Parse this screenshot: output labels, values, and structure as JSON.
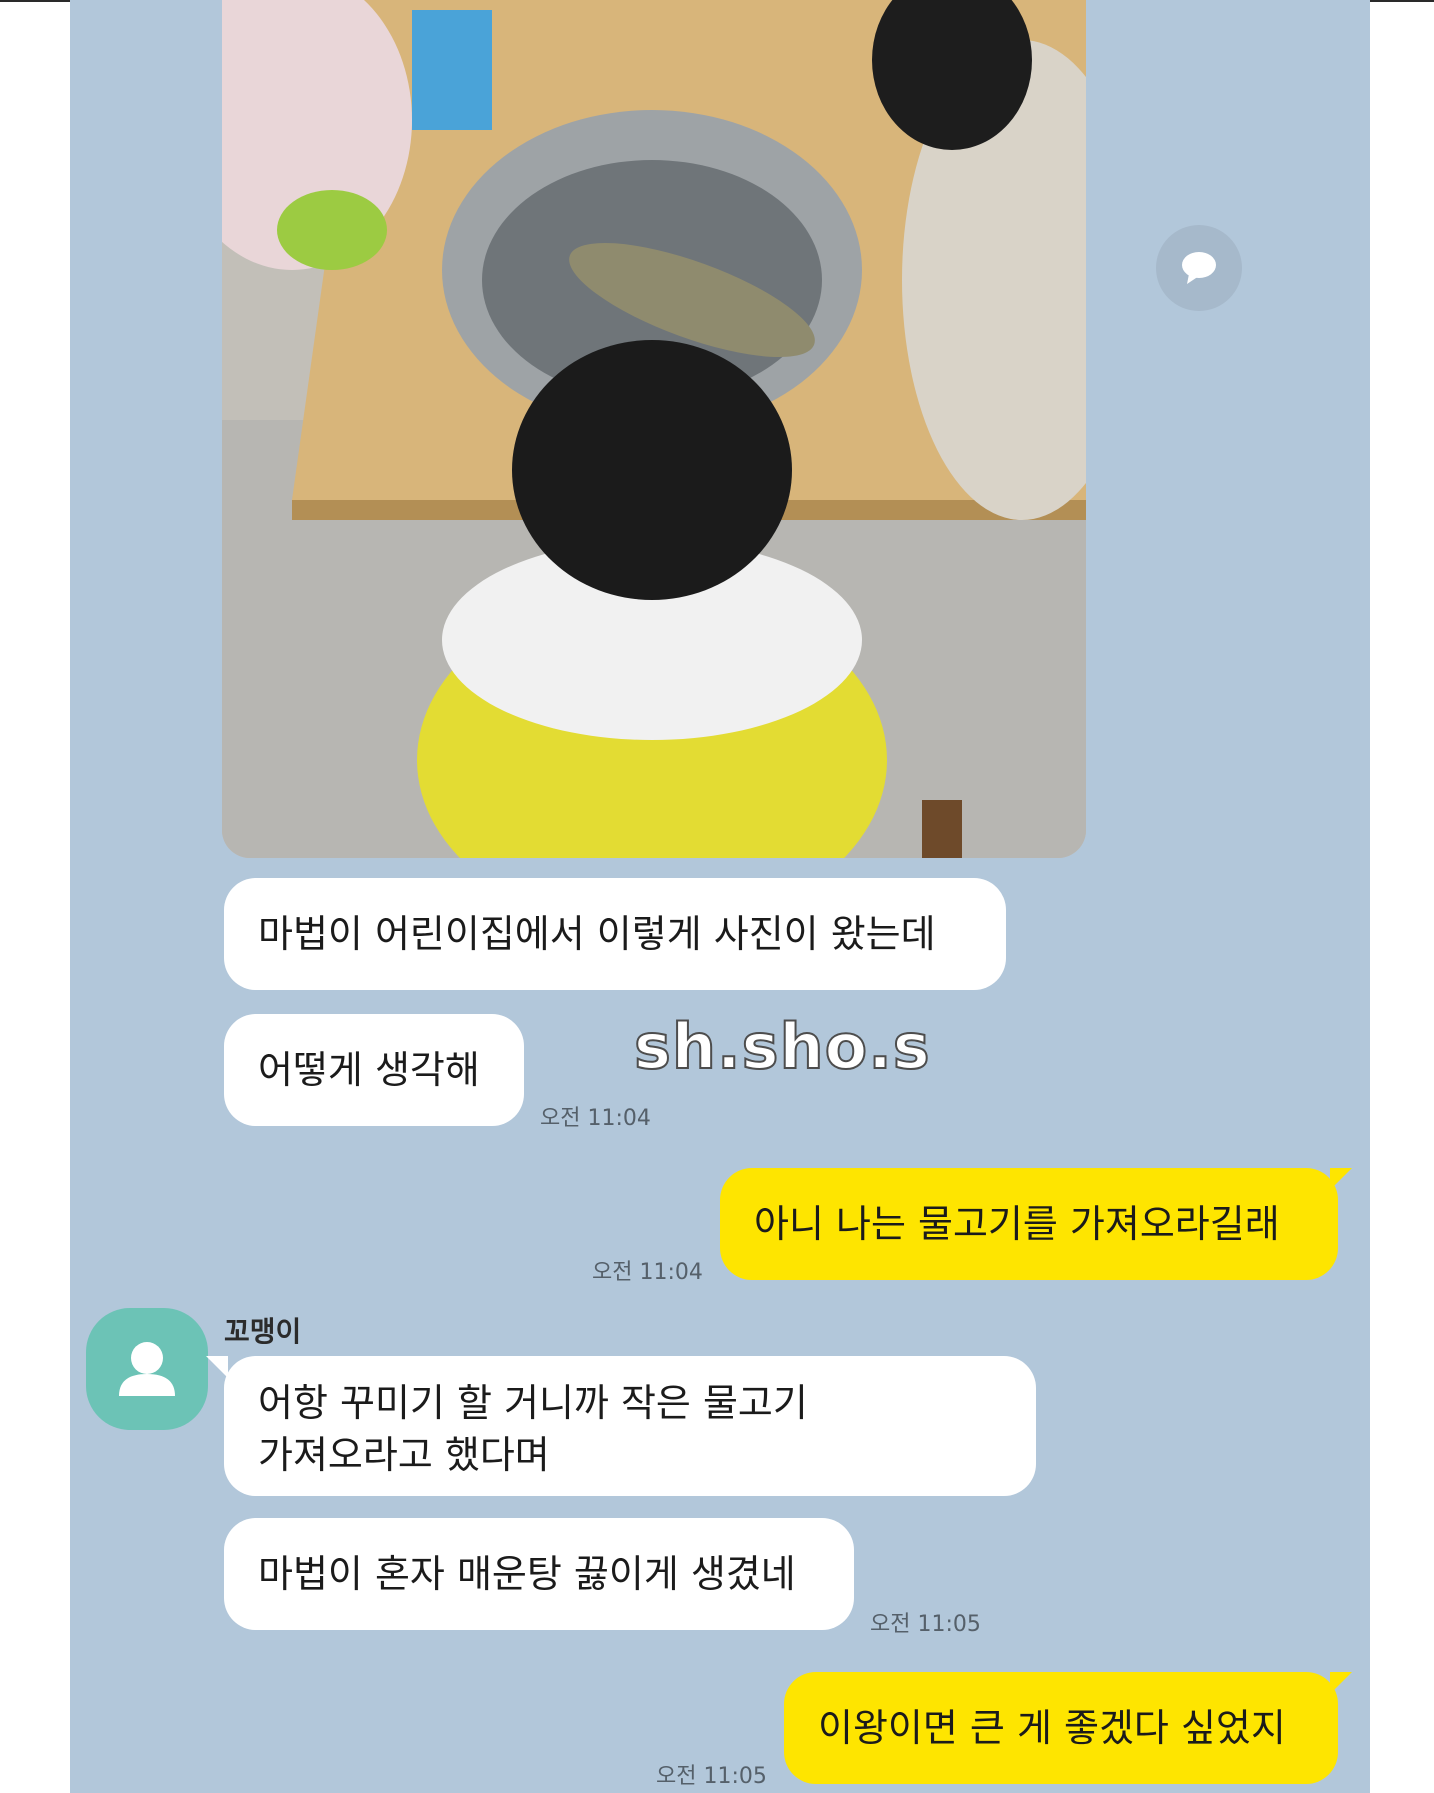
{
  "messages": [
    {
      "text": "마법이 어린이집에서 이렇게 사진이 왔는데"
    },
    {
      "text": "어떻게 생각해",
      "time": "오전 11:04"
    },
    {
      "text": "아니 나는 물고기를 가져오라길래",
      "time": "오전 11:04"
    },
    {
      "sender": "꼬맹이",
      "text_line1": "어항 꾸미기 할 거니까 작은 물고기",
      "text_line2": "가져오라고 했다며"
    },
    {
      "text": "마법이 혼자 매운탕 끓이게 생겼네",
      "time": "오전 11:05"
    },
    {
      "text": "이왕이면 큰 게 좋겠다 싶었지",
      "time": "오전 11:05"
    }
  ],
  "watermark": "sh.sho.s",
  "colors": {
    "chat_background": "#b2c7da",
    "incoming_bubble": "#ffffff",
    "outgoing_bubble": "#fee500",
    "avatar": "#6cc3b6"
  },
  "icons": {
    "share": "speech-bubble-icon",
    "avatar": "person-icon"
  }
}
